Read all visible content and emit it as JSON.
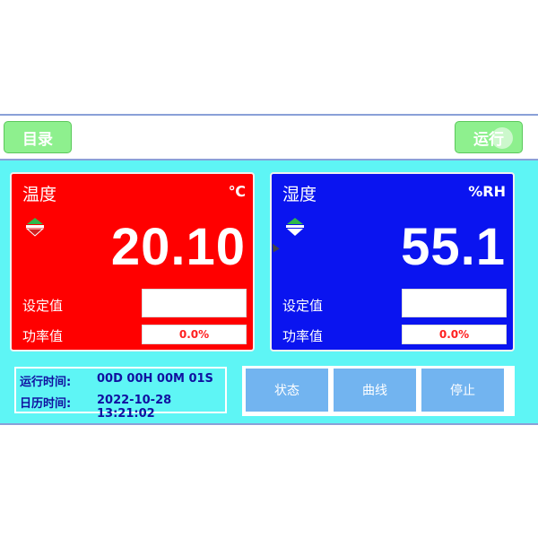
{
  "topbar": {
    "menu_label": "目录",
    "run_label": "运行"
  },
  "temperature": {
    "title": "温度",
    "unit": "℃",
    "value": "20.10",
    "setpoint_label": "设定值",
    "setpoint_value": "",
    "power_label": "功率值",
    "power_value": "0.0%"
  },
  "humidity": {
    "title": "湿度",
    "unit": "%RH",
    "value": "55.1",
    "setpoint_label": "设定值",
    "setpoint_value": "",
    "power_label": "功率值",
    "power_value": "0.0%"
  },
  "info": {
    "runtime_label": "运行时间:",
    "runtime_value": "00D 00H 00M 01S",
    "calendar_label": "日历时间:",
    "calendar_value": "2022-10-28 13:21:02"
  },
  "actions": {
    "status": "状态",
    "curve": "曲线",
    "stop": "停止"
  },
  "colors": {
    "background": "#5ef5f5",
    "temp_panel": "#ff0000",
    "hum_panel": "#0a14f0",
    "button_green": "#8ef08e",
    "button_blue": "#72b4f0"
  }
}
